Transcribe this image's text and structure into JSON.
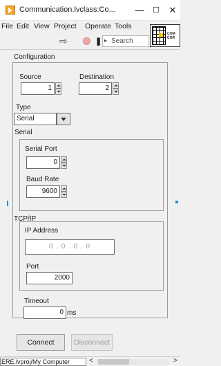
{
  "window": {
    "title": "Communication.lvclass:Co...",
    "minimize_glyph": "—",
    "maximize_glyph": "☐",
    "close_glyph": "✕"
  },
  "menu": {
    "items": [
      "File",
      "Edit",
      "View",
      "Project",
      "Operate",
      "Tools"
    ]
  },
  "toolbar": {
    "run_icon": "run-arrow-icon",
    "abort_icon": "abort-stop-icon",
    "pause_icon": "pause-icon",
    "search_placeholder": "Search"
  },
  "vi_icon": {
    "label_line1": "COM",
    "label_line2": "COR"
  },
  "configuration": {
    "title": "Configuration",
    "source": {
      "label": "Source",
      "value": "1"
    },
    "destination": {
      "label": "Destination",
      "value": "2"
    },
    "type": {
      "label": "Type",
      "value": "Serial"
    },
    "serial": {
      "title": "Serial",
      "serial_port": {
        "label": "Serial Port",
        "value": "0"
      },
      "baud_rate": {
        "label": "Baud Rate",
        "value": "9600"
      }
    },
    "tcpip": {
      "title": "TCP/IP",
      "ip_address": {
        "label": "IP Address",
        "value": "0 . 0 . 0 . 0"
      },
      "port": {
        "label": "Port",
        "value": "2000"
      }
    },
    "timeout": {
      "label": "Timeout",
      "value": "0",
      "unit": "ms"
    }
  },
  "buttons": {
    "connect": "Connect",
    "disconnect": "Disconnect"
  },
  "status": {
    "path": "ERE.lvproj/My Computer",
    "scroll_left_glyph": "<",
    "scroll_right_glyph": ">"
  },
  "colors": {
    "app_icon": "#f5a623",
    "accent_blue": "#1d8fe0",
    "abort_red": "#f1a5a5"
  }
}
